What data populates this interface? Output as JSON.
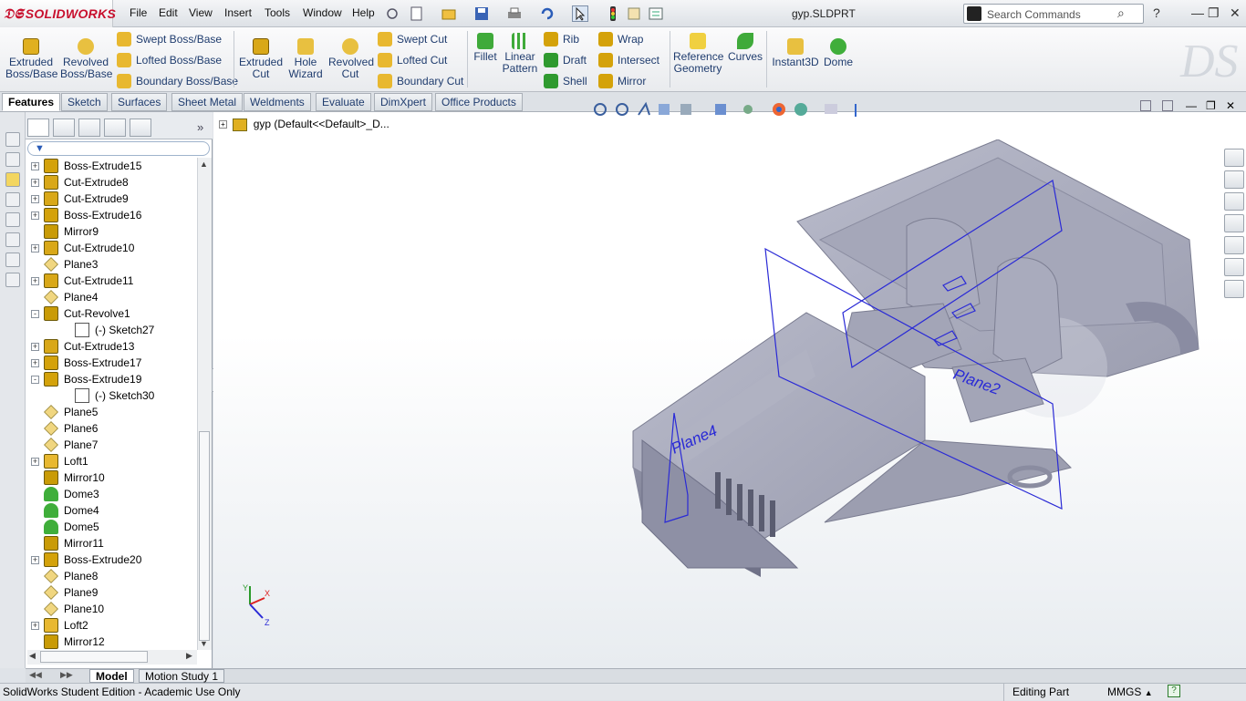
{
  "app": {
    "logo_text": "SOLIDWORKS",
    "document_title": "gyp.SLDPRT",
    "menu": [
      "File",
      "Edit",
      "View",
      "Insert",
      "Tools",
      "Window",
      "Help"
    ],
    "search_placeholder": "Search Commands"
  },
  "commands": {
    "extruded_boss": "Extruded Boss/Base",
    "revolved_boss": "Revolved Boss/Base",
    "swept_boss": "Swept Boss/Base",
    "lofted_boss": "Lofted Boss/Base",
    "boundary_boss": "Boundary Boss/Base",
    "extruded_cut": "Extruded Cut",
    "hole_wizard": "Hole Wizard",
    "revolved_cut": "Revolved Cut",
    "swept_cut": "Swept Cut",
    "lofted_cut": "Lofted Cut",
    "boundary_cut": "Boundary Cut",
    "fillet": "Fillet",
    "linear_pattern": "Linear Pattern",
    "rib": "Rib",
    "draft": "Draft",
    "shell": "Shell",
    "wrap": "Wrap",
    "intersect": "Intersect",
    "mirror": "Mirror",
    "reference_geometry": "Reference Geometry",
    "curves": "Curves",
    "instant3d": "Instant3D",
    "dome": "Dome"
  },
  "tabs": [
    "Features",
    "Sketch",
    "Surfaces",
    "Sheet Metal",
    "Weldments",
    "Evaluate",
    "DimXpert",
    "Office Products"
  ],
  "feature_tree": {
    "root": "gyp  (Default<<Default>_D...",
    "items": [
      {
        "label": "Boss-Extrude15",
        "type": "boss",
        "expand": "+"
      },
      {
        "label": "Cut-Extrude8",
        "type": "cut",
        "expand": "+"
      },
      {
        "label": "Cut-Extrude9",
        "type": "cut",
        "expand": "+"
      },
      {
        "label": "Boss-Extrude16",
        "type": "boss",
        "expand": "+"
      },
      {
        "label": "Mirror9",
        "type": "mirror",
        "expand": ""
      },
      {
        "label": "Cut-Extrude10",
        "type": "cut",
        "expand": "+"
      },
      {
        "label": "Plane3",
        "type": "plane",
        "expand": ""
      },
      {
        "label": "Cut-Extrude11",
        "type": "cut",
        "expand": "+"
      },
      {
        "label": "Plane4",
        "type": "plane",
        "expand": ""
      },
      {
        "label": "Cut-Revolve1",
        "type": "revolve",
        "expand": "−"
      },
      {
        "label": "(-) Sketch27",
        "type": "sketch",
        "expand": ""
      },
      {
        "label": "Cut-Extrude13",
        "type": "cut",
        "expand": "+"
      },
      {
        "label": "Boss-Extrude17",
        "type": "boss",
        "expand": "+"
      },
      {
        "label": "Boss-Extrude19",
        "type": "boss",
        "expand": "−"
      },
      {
        "label": "(-) Sketch30",
        "type": "sketch",
        "expand": ""
      },
      {
        "label": "Plane5",
        "type": "plane",
        "expand": ""
      },
      {
        "label": "Plane6",
        "type": "plane",
        "expand": ""
      },
      {
        "label": "Plane7",
        "type": "plane",
        "expand": ""
      },
      {
        "label": "Loft1",
        "type": "loft",
        "expand": "+"
      },
      {
        "label": "Mirror10",
        "type": "mirror",
        "expand": ""
      },
      {
        "label": "Dome3",
        "type": "dome",
        "expand": ""
      },
      {
        "label": "Dome4",
        "type": "dome",
        "expand": ""
      },
      {
        "label": "Dome5",
        "type": "dome",
        "expand": ""
      },
      {
        "label": "Mirror11",
        "type": "mirror",
        "expand": ""
      },
      {
        "label": "Boss-Extrude20",
        "type": "boss",
        "expand": "+"
      },
      {
        "label": "Plane8",
        "type": "plane",
        "expand": ""
      },
      {
        "label": "Plane9",
        "type": "plane",
        "expand": ""
      },
      {
        "label": "Plane10",
        "type": "plane",
        "expand": ""
      },
      {
        "label": "Loft2",
        "type": "loft",
        "expand": "+"
      },
      {
        "label": "Mirror12",
        "type": "mirror",
        "expand": ""
      }
    ]
  },
  "viewport": {
    "plane_labels": [
      "Plane4",
      "Plane2"
    ],
    "triad": [
      "X",
      "Y",
      "Z"
    ]
  },
  "bottom_tabs": [
    "Model",
    "Motion Study 1"
  ],
  "status": {
    "left": "SolidWorks Student Edition - Academic Use Only",
    "mode": "Editing Part",
    "units": "MMGS"
  },
  "colors": {
    "accent": "#1f3c6e",
    "boss_icon": "#d4a20a",
    "cut_icon": "#c99b06",
    "dome": "#3fae3a",
    "model": "#a9abbb",
    "plane": "#2a2ad6"
  }
}
